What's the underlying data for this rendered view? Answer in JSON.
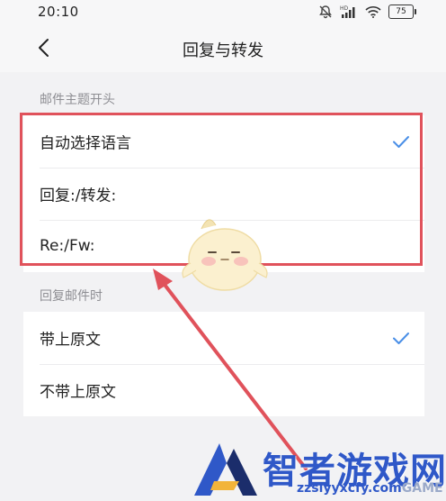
{
  "status_bar": {
    "time": "20:10",
    "battery_level": "75",
    "icons": [
      "mute-icon",
      "hd-signal-icon",
      "wifi-icon",
      "battery-icon"
    ]
  },
  "header": {
    "title": "回复与转发",
    "back_icon": "chevron-left-icon"
  },
  "sections": {
    "subject_prefix": {
      "title": "邮件主题开头",
      "options": [
        {
          "label": "自动选择语言",
          "selected": true
        },
        {
          "label": "回复:/转发:",
          "selected": false
        },
        {
          "label": "Re:/Fw:",
          "selected": false
        }
      ]
    },
    "reply_body": {
      "title": "回复邮件时",
      "options": [
        {
          "label": "带上原文",
          "selected": true
        },
        {
          "label": "不带上原文",
          "selected": false
        }
      ]
    }
  },
  "watermark": {
    "text": "智者游戏网",
    "url": "zzslyyxcfy.com",
    "url_faint": "GAME"
  },
  "colors": {
    "accent": "#4a8fe7",
    "highlight": "#e0525b",
    "background": "#f2f2f4",
    "card": "#ffffff",
    "section_text": "#8e8e93"
  }
}
